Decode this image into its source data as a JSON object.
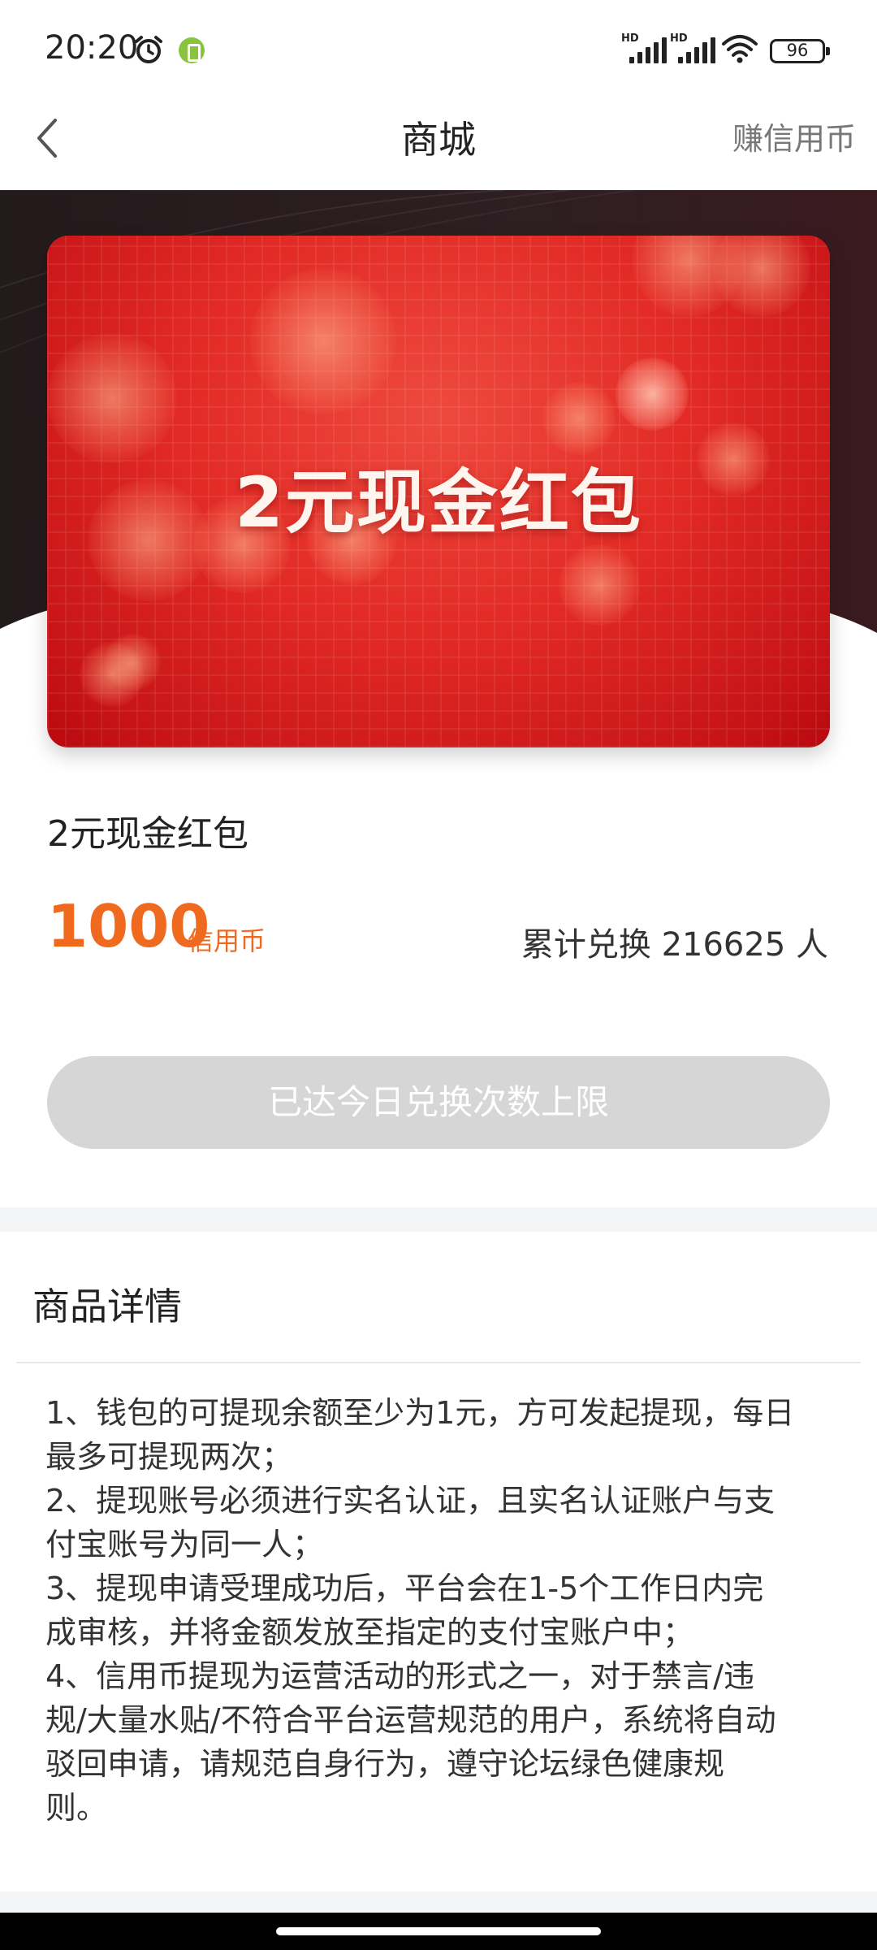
{
  "status_bar": {
    "time": "20:20",
    "battery": "96",
    "signal_1_label": "HD",
    "signal_2_label": "HD"
  },
  "header": {
    "title": "商城",
    "earn_link": "赚信用币"
  },
  "banner": {
    "card_title": "2元现金红包"
  },
  "product": {
    "name": "2元现金红包",
    "price": "1000",
    "price_unit": "信用币",
    "exchanged_text": "累计兑换 216625 人"
  },
  "action": {
    "limit_label": "已达今日兑换次数上限"
  },
  "details": {
    "title": "商品详情",
    "lines": [
      "1、钱包的可提现余额至少为1元，方可发起提现，每日",
      "最多可提现两次；",
      "2、提现账号必须进行实名认证，且实名认证账户与支",
      "付宝账号为同一人；",
      "3、提现申请受理成功后，平台会在1-5个工作日内完",
      "成审核，并将金额发放至指定的支付宝账户中；",
      "4、信用币提现为运营活动的形式之一，对于禁言/违",
      "规/大量水贴/不符合平台运营规范的用户，系统将自动",
      "驳回申请，请规范自身行为，遵守论坛绿色健康规",
      "则。"
    ]
  },
  "colors": {
    "accent": "#ef6a1f",
    "card_red": "#e32b26",
    "button_disabled": "#d6d6d6"
  },
  "icons": {
    "alarm": "alarm-icon",
    "app_notification": "app-notification-icon",
    "wifi": "wifi-icon",
    "back": "back-icon"
  }
}
